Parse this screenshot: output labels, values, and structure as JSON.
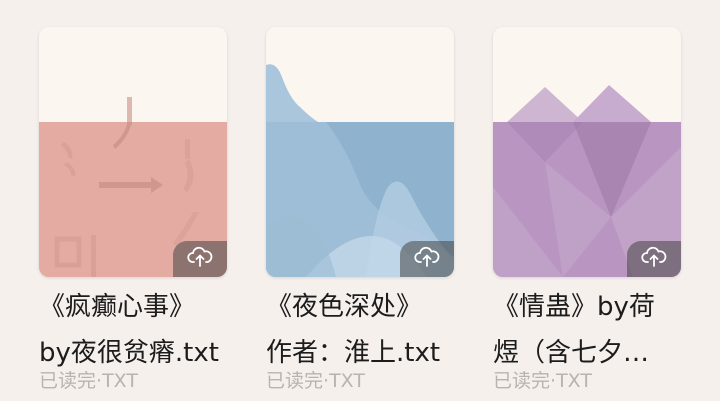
{
  "books": [
    {
      "title_line1": "《疯癫心事》",
      "title_line2": "by夜很贫瘠.txt",
      "status": "已读完",
      "format": "TXT",
      "cloud_icon": "cloud-upload-icon",
      "accent": "#e3aba2"
    },
    {
      "title_line1": "《夜色深处》",
      "title_line2": "作者：淮上.txt",
      "status": "已读完",
      "format": "TXT",
      "cloud_icon": "cloud-upload-icon",
      "accent": "#8fb3cf"
    },
    {
      "title_line1": "《情蛊》by荷",
      "title_line2": "煜（含七夕…",
      "status": "已读完",
      "format": "TXT",
      "cloud_icon": "cloud-upload-icon",
      "accent": "#b996c1"
    }
  ],
  "meta_separator": "·"
}
